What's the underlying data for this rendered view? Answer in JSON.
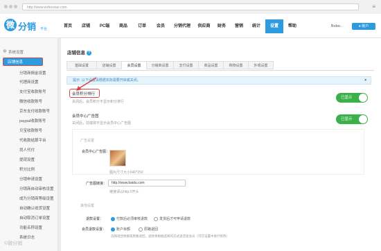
{
  "browser": {
    "url": "http://www.wxfenxiao.com"
  },
  "logo": {
    "mark": "微",
    "name": "分销",
    "sub": "平台"
  },
  "nav": [
    "首页",
    "店铺",
    "PC端",
    "商品",
    "订单",
    "会员",
    "分销代理",
    "供应商",
    "财务",
    "营销",
    "统计",
    "设置",
    "帮助"
  ],
  "nav_active_index": 11,
  "user": {
    "name": "Bobo..",
    "account_button": "账户"
  },
  "sidebar": {
    "header": "系统设置",
    "active": "店铺信息",
    "items": [
      "分销商佣金设置",
      "代理商设置",
      "支付宝收款账号",
      "微信收款账号",
      "京东支付收款账号",
      "paypal收款账号",
      "贝宝收款账号",
      "代收款结算平台",
      "找人代付",
      "提现设置",
      "积分比例",
      "分销申请设置",
      "分销商自动审核设置",
      "成为分销商等级设置",
      "自动确认收货设置",
      "自动取消订单设置",
      "功能名称设置",
      "系统日志"
    ]
  },
  "page": {
    "title": "店铺信息"
  },
  "tabs": [
    "基础设置",
    "店铺设置",
    "会员设置",
    "分销商设置",
    "支付设置",
    "商品设置",
    "购物设置",
    "外观设置"
  ],
  "tab_active_index": 2,
  "notice": {
    "text": "提示: 以下设置请根据实际需要开启或关闭。",
    "close": "×"
  },
  "settings": {
    "rank": {
      "label": "会员积分排行",
      "desc": "关闭后，会员积分不显示积分排行",
      "toggle": "已显示"
    },
    "ad": {
      "label": "会员中心广告图",
      "desc": "关闭后，前端将不显示会员中心广告图",
      "toggle": "已显示"
    }
  },
  "ad_section": {
    "title": "广告设置",
    "image_label": "会员中心广告图：",
    "image_hint": "图片尺寸大小640*250",
    "link_label": "广告图链接：",
    "link_value": "http://www.baidu.com",
    "link_hint": "链接请以http://开头"
  },
  "other": {
    "title": "其他设置",
    "return_label": "退款设置：",
    "return_options": [
      "付款后必须审核退款",
      "发货后才可申请退款"
    ],
    "balance_label": "会员退款设置：",
    "balance_options": [
      "账户余额",
      "原路退回"
    ],
    "balance_desc": "选择退回余额或原路退回，退款将根据选择的方式退还给会员（可在设置中进行修改）"
  },
  "watermark": "©微分销"
}
